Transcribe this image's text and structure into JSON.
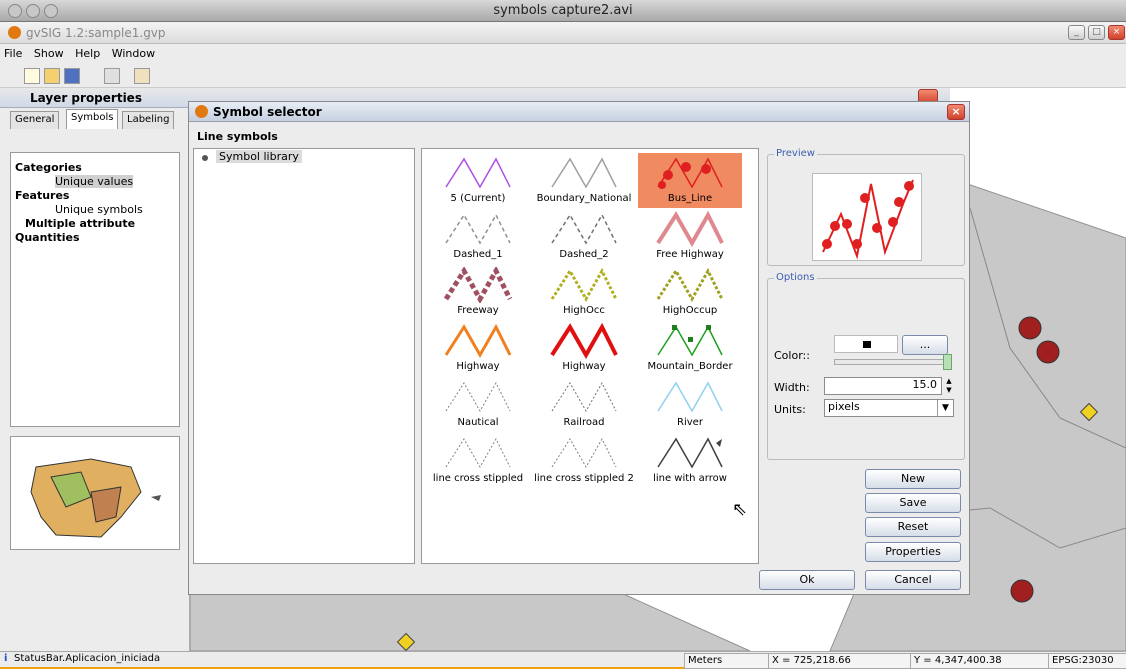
{
  "mac_window": {
    "title": "symbols capture2.avi"
  },
  "app": {
    "title": "gvSIG 1.2:sample1.gvp"
  },
  "menu": [
    "File",
    "Show",
    "Help",
    "Window"
  ],
  "layer_properties": {
    "title": "Layer properties",
    "tabs": [
      "General",
      "Symbols",
      "Labeling"
    ],
    "active_tab": "Symbols",
    "tree": [
      {
        "label": "Categories",
        "bold": true
      },
      {
        "label": "Unique values",
        "selected": true
      },
      {
        "label": "Features",
        "bold": true
      },
      {
        "label": "Unique symbols"
      },
      {
        "label": "Multiple attribute",
        "bold": true
      },
      {
        "label": "Quantities",
        "bold": true
      }
    ]
  },
  "symbol_selector": {
    "title": "Symbol selector",
    "section": "Line symbols",
    "library": "Symbol library",
    "symbols": [
      {
        "name": "5 (Current)",
        "color": "#b050e0",
        "style": "solid"
      },
      {
        "name": "Boundary_National",
        "color": "#a0a0a0",
        "style": "solid"
      },
      {
        "name": "Bus_Line",
        "color": "#e02020",
        "style": "bus",
        "selected": true
      },
      {
        "name": "Dashed_1",
        "color": "#909090",
        "style": "dash"
      },
      {
        "name": "Dashed_2",
        "color": "#707070",
        "style": "dash2"
      },
      {
        "name": "Free Highway",
        "color": "#e08890",
        "style": "double"
      },
      {
        "name": "Freeway",
        "color": "#a05060",
        "style": "freeway"
      },
      {
        "name": "HighOcc",
        "color": "#b0b020",
        "style": "hocc"
      },
      {
        "name": "HighOccup",
        "color": "#a0a020",
        "style": "hocc"
      },
      {
        "name": "Highway",
        "color": "#f08020",
        "style": "highway"
      },
      {
        "name": "Highway",
        "color": "#e01010",
        "style": "thick"
      },
      {
        "name": "Mountain_Border",
        "color": "#20a020",
        "style": "mountain"
      },
      {
        "name": "Nautical",
        "color": "#808080",
        "style": "nautical"
      },
      {
        "name": "Railroad",
        "color": "#707070",
        "style": "rail"
      },
      {
        "name": "River",
        "color": "#90d0f0",
        "style": "solid"
      },
      {
        "name": "line cross stippled",
        "color": "#808080",
        "style": "cross"
      },
      {
        "name": "line cross stippled 2",
        "color": "#808080",
        "style": "cross"
      },
      {
        "name": "line with arrow",
        "color": "#404040",
        "style": "arrow"
      }
    ],
    "preview_label": "Preview",
    "options_label": "Options",
    "color_label": "Color::",
    "color_button": "...",
    "width_label": "Width:",
    "width_value": "15.0",
    "units_label": "Units:",
    "units_value": "pixels",
    "buttons": {
      "new": "New",
      "save": "Save",
      "reset": "Reset",
      "properties": "Properties",
      "ok": "Ok",
      "cancel": "Cancel"
    }
  },
  "status": {
    "message": "StatusBar.Aplicacion_iniciada",
    "units": "Meters",
    "x": "X = 725,218.66",
    "y": "Y = 4,347,400.38",
    "epsg": "EPSG:23030"
  }
}
